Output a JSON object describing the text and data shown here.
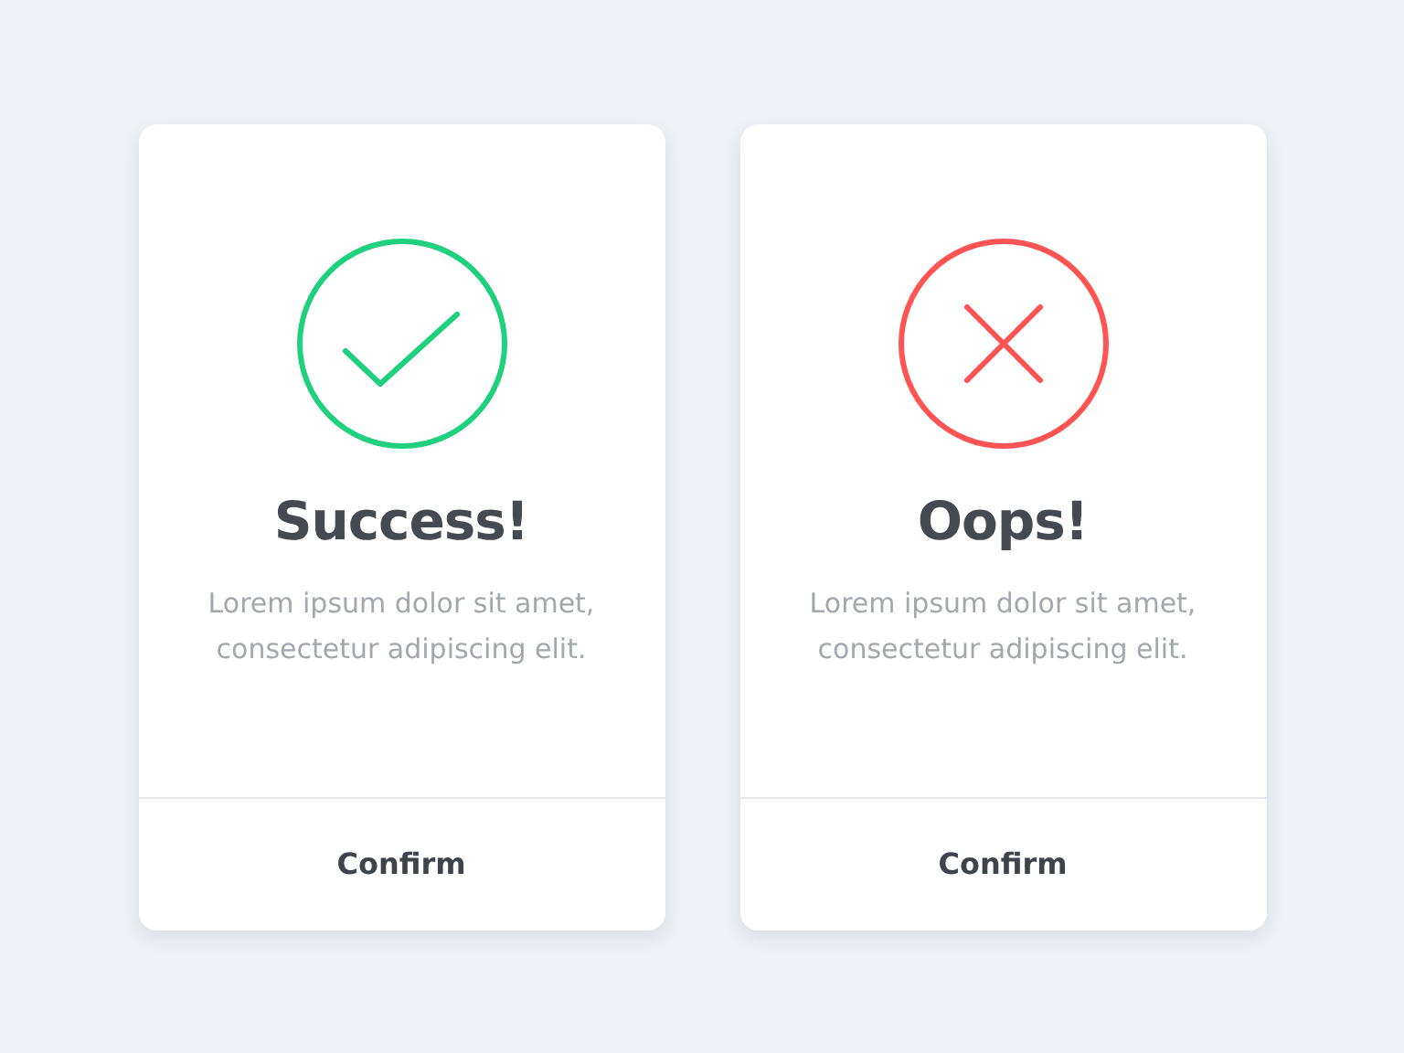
{
  "cards": [
    {
      "kind": "success",
      "title": "Success!",
      "message": "Lorem ipsum dolor sit amet, consectetur adipiscing elit.",
      "button": "Confirm"
    },
    {
      "kind": "error",
      "title": "Oops!",
      "message": "Lorem ipsum dolor sit amet, consectetur adipiscing elit.",
      "button": "Confirm"
    }
  ]
}
